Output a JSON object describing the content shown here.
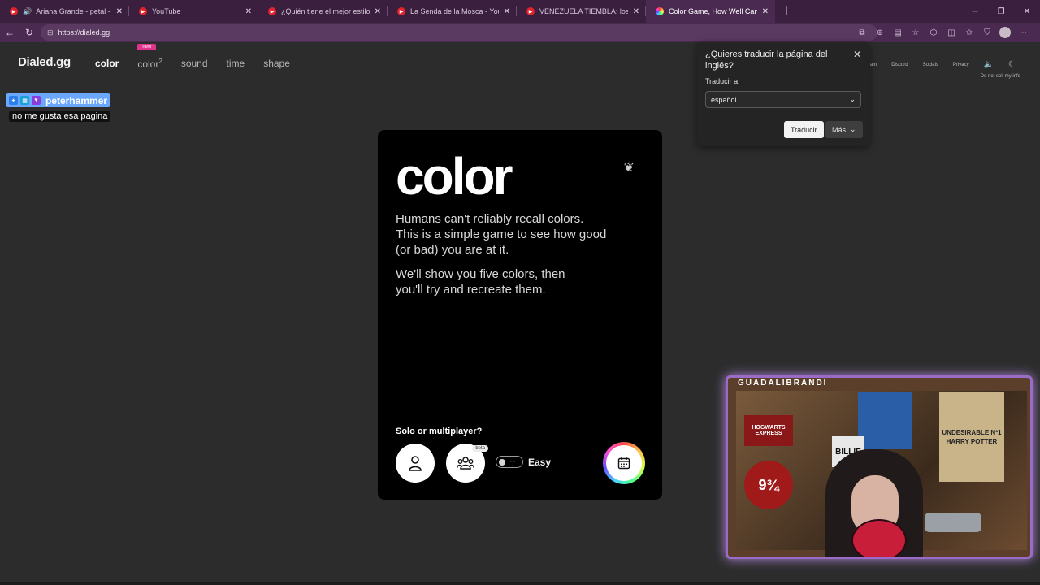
{
  "browser": {
    "tabs": [
      {
        "title": "Ariana Grande - petal - YouTu",
        "favicon": "youtube-icon",
        "audio": true,
        "active": false
      },
      {
        "title": "YouTube",
        "favicon": "youtube-icon",
        "audio": false,
        "active": false
      },
      {
        "title": "¿Quién tiene el mejor estilo? Lit K",
        "favicon": "youtube-icon",
        "audio": false,
        "active": false
      },
      {
        "title": "La Senda de la Mosca - YouTube",
        "favicon": "youtube-icon",
        "audio": false,
        "active": false
      },
      {
        "title": "VENEZUELA TIEMBLA: los héroes -",
        "favicon": "youtube-icon",
        "audio": false,
        "active": false
      },
      {
        "title": "Color Game, How Well Can You Re",
        "favicon": "rainbow-icon",
        "audio": false,
        "active": true
      }
    ],
    "url": "https://dialed.gg"
  },
  "site": {
    "logo": "Dialed.gg",
    "nav": {
      "color": "color",
      "color2": "color",
      "color2_sup": "2",
      "new_tag": "new",
      "sound": "sound",
      "time": "time",
      "shape": "shape"
    },
    "right_links": {
      "instagram": "Instagram",
      "discord": "Discord",
      "socials": "Socials",
      "privacy": "Privacy",
      "do_not_sell": "Do not sell my info"
    }
  },
  "chat": {
    "username": "peterhammer",
    "message": "no me gusta esa pagina"
  },
  "game_card": {
    "title": "color",
    "paragraph1": "Humans can't reliably recall colors. This is a simple game to see how good (or bad) you are at it.",
    "paragraph2": "We'll show you five colors, then you'll try and recreate them.",
    "question": "Solo or multiplayer?",
    "beta_tag": "beta",
    "difficulty_label": "Easy"
  },
  "translate_popup": {
    "question": "¿Quieres traducir la página del inglés?",
    "translate_to_label": "Traducir a",
    "selected_language": "español",
    "translate_button": "Traducir",
    "more_button": "Más"
  },
  "stream": {
    "streamer_name": "GUADALIBRANDI",
    "posters": {
      "hogwarts": "HOGWARTS EXPRESS",
      "platform": "9¾",
      "billie": "BILLIE",
      "undesirable": "UNDESIRABLE Nº1 HARRY POTTER"
    }
  },
  "colors": {
    "tabbar": "#3a1f3f",
    "page_bg": "#2c2c2c",
    "card_bg": "#000000",
    "new_tag": "#e0338d",
    "cam_border": "#9a6bc8"
  }
}
